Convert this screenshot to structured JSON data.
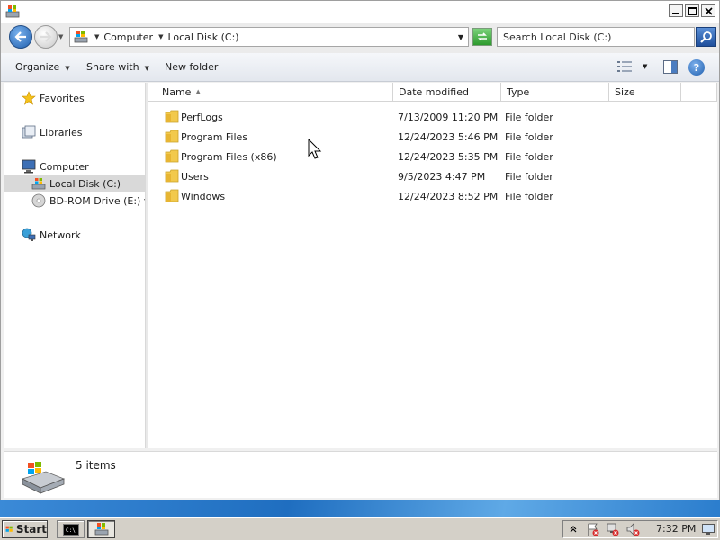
{
  "window": {
    "title": ""
  },
  "address": {
    "crumbs": [
      "Computer",
      "Local Disk (C:)"
    ],
    "search_placeholder": "Search Local Disk (C:)"
  },
  "toolbar": {
    "organize": "Organize",
    "share_with": "Share with",
    "new_folder": "New folder"
  },
  "nav": {
    "favorites": "Favorites",
    "libraries": "Libraries",
    "computer": "Computer",
    "local_disk": "Local Disk (C:)",
    "bd_rom": "BD-ROM Drive (E:) virt",
    "network": "Network"
  },
  "columns": {
    "name": "Name",
    "date_modified": "Date modified",
    "type": "Type",
    "size": "Size"
  },
  "files": [
    {
      "name": "PerfLogs",
      "date": "7/13/2009 11:20 PM",
      "type": "File folder",
      "size": ""
    },
    {
      "name": "Program Files",
      "date": "12/24/2023 5:46 PM",
      "type": "File folder",
      "size": ""
    },
    {
      "name": "Program Files (x86)",
      "date": "12/24/2023 5:35 PM",
      "type": "File folder",
      "size": ""
    },
    {
      "name": "Users",
      "date": "9/5/2023 4:47 PM",
      "type": "File folder",
      "size": ""
    },
    {
      "name": "Windows",
      "date": "12/24/2023 8:52 PM",
      "type": "File folder",
      "size": ""
    }
  ],
  "details": {
    "count": "5 items"
  },
  "taskbar": {
    "start": "Start",
    "clock": "7:32 PM"
  },
  "colors": {
    "folder": "#f2c94c",
    "selection": "#d9d9d9",
    "aero_blue": "#1f6ec0"
  }
}
